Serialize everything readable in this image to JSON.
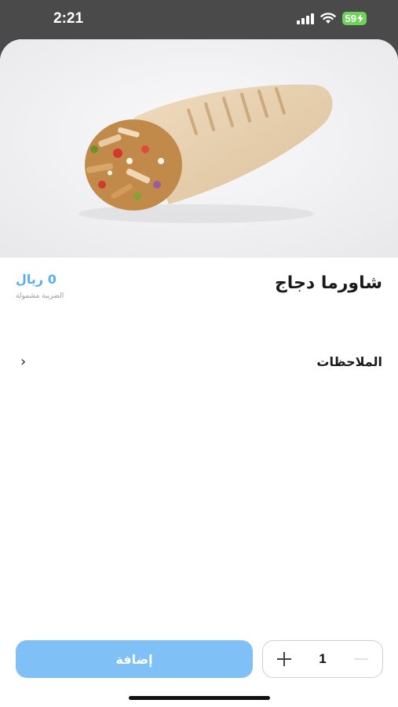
{
  "status_bar": {
    "time": "2:21",
    "battery": "59"
  },
  "product": {
    "title": "شاورما دجاج",
    "price": "0 ريال",
    "tax_note": "الضريبة مشمولة",
    "image_alt": "Chicken shawarma wrap"
  },
  "notes": {
    "label": "الملاحظات",
    "chevron": "›"
  },
  "cart": {
    "add_label": "إضافة",
    "quantity": "1"
  },
  "colors": {
    "accent": "#7fc0f7",
    "price": "#5aaef0",
    "battery": "#6fd25a"
  }
}
